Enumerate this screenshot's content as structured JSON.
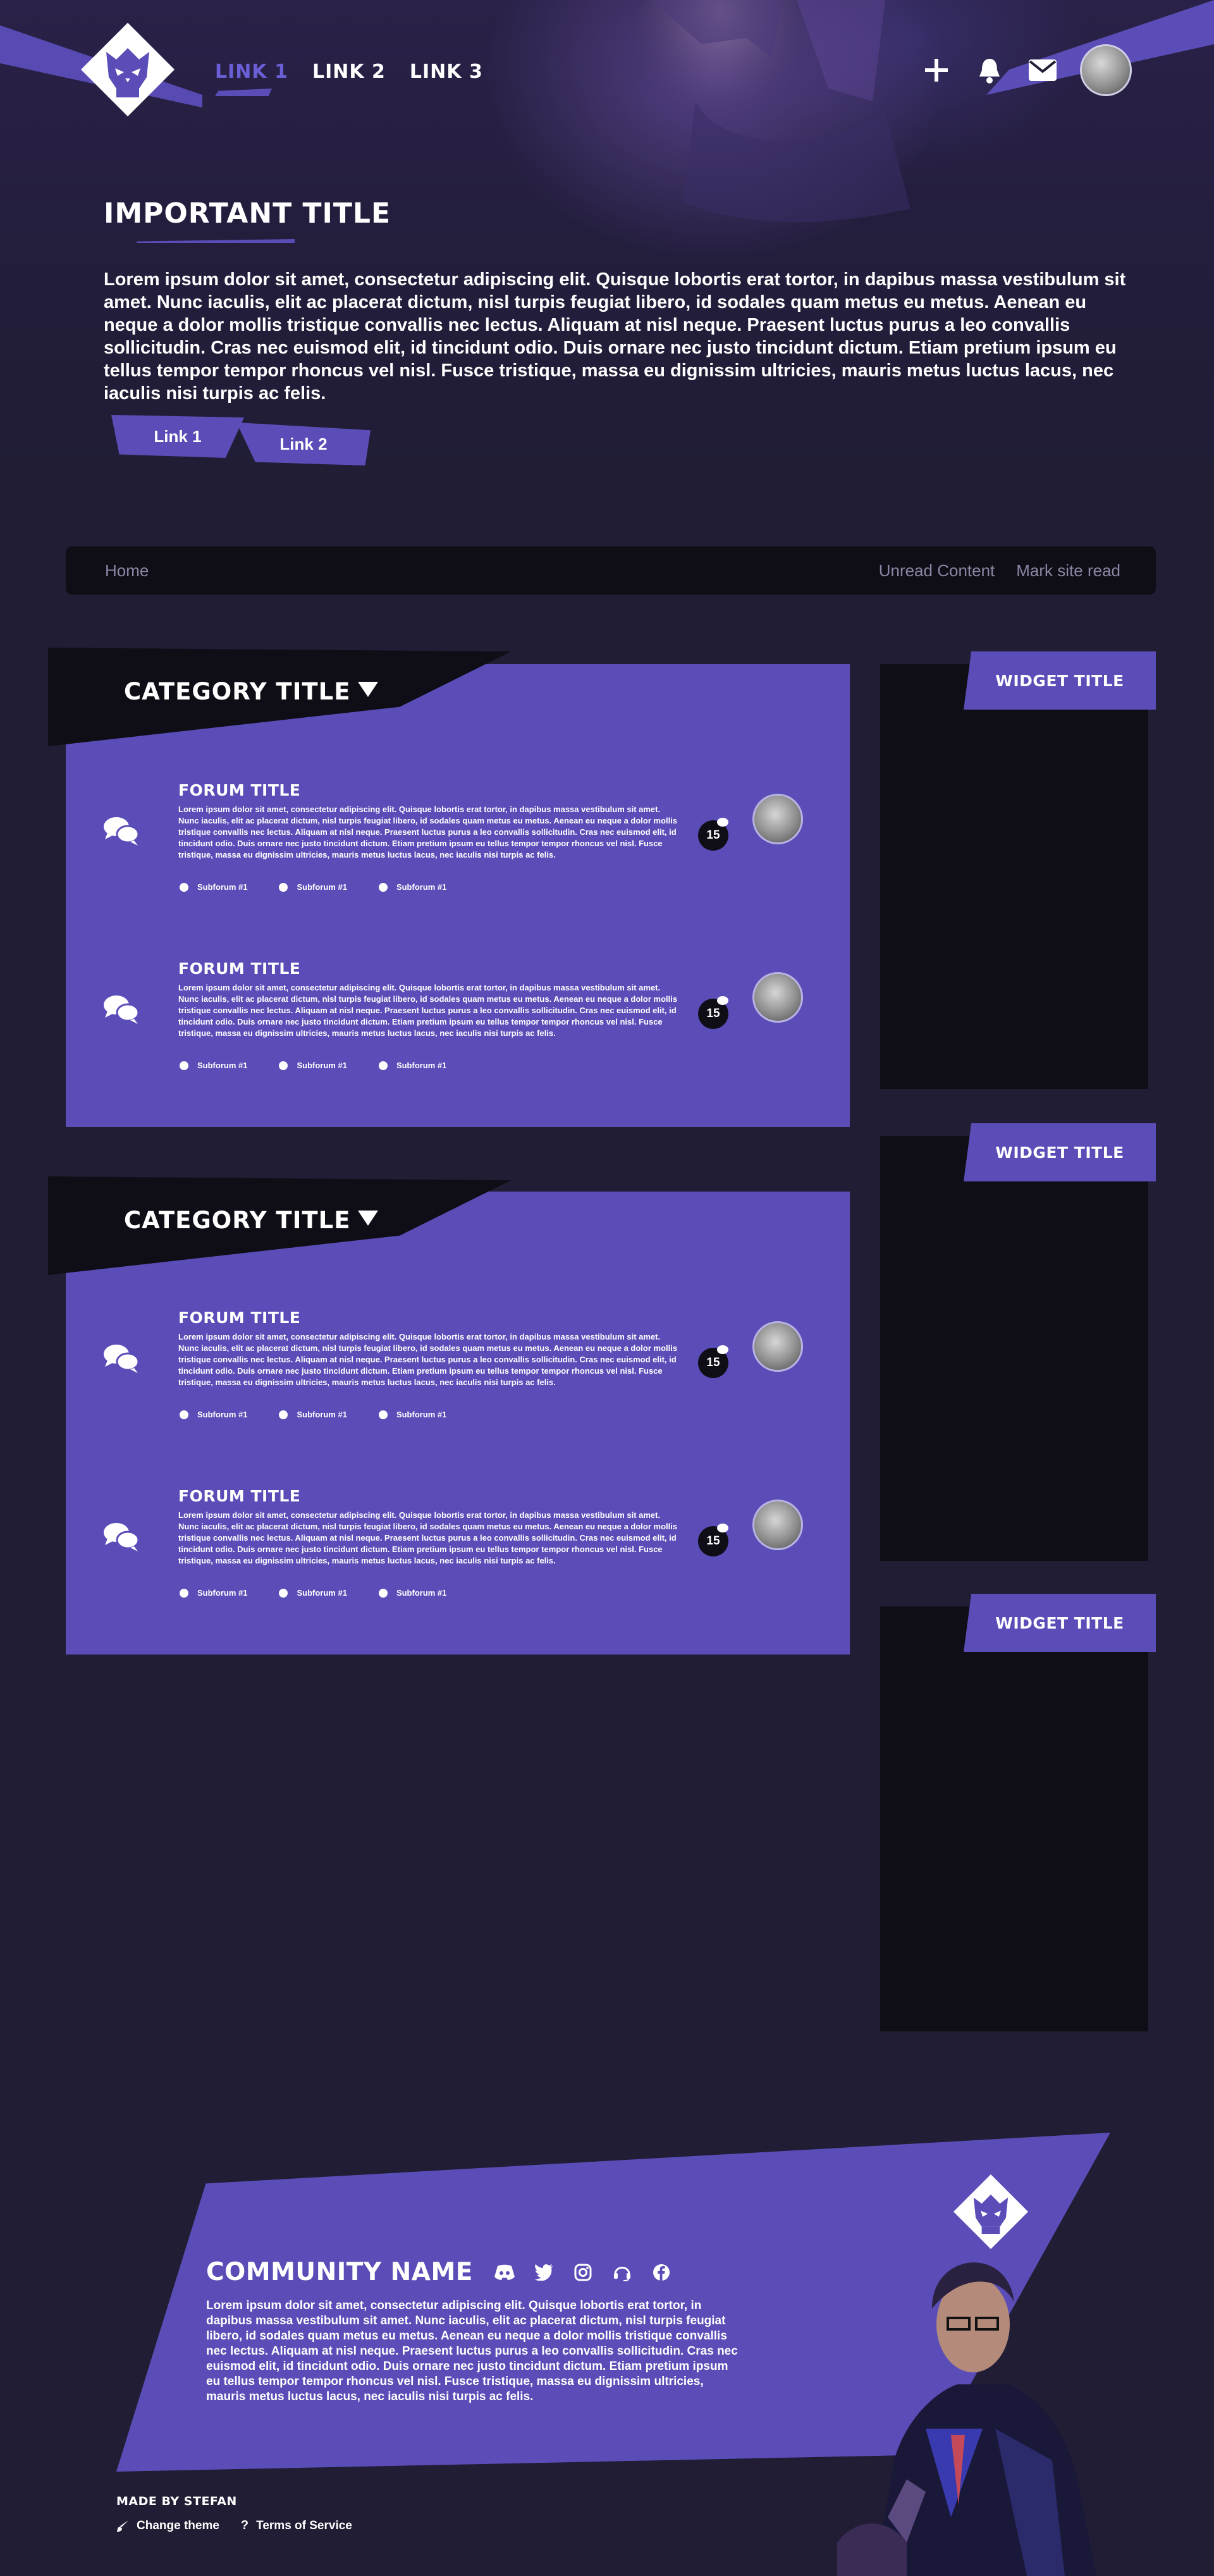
{
  "nav": {
    "links": [
      "LINK 1",
      "LINK 2",
      "LINK 3"
    ]
  },
  "hero": {
    "title": "IMPORTANT TITLE",
    "text": "Lorem ipsum dolor sit amet, consectetur adipiscing elit. Quisque lobortis erat tortor, in dapibus massa vestibulum sit amet. Nunc iaculis, elit ac placerat dictum, nisl turpis feugiat libero, id sodales quam metus eu metus. Aenean eu neque a dolor mollis tristique convallis nec lectus. Aliquam at nisl neque. Praesent luctus purus a leo convallis sollicitudin. Cras nec euismod elit, id tincidunt odio. Duis ornare nec justo tincidunt dictum. Etiam pretium ipsum eu tellus tempor tempor rhoncus vel nisl. Fusce tristique, massa eu dignissim ultricies, mauris metus luctus lacus, nec iaculis nisi turpis ac felis.",
    "button1": "Link 1",
    "button2": "Link 2"
  },
  "breadcrumb": {
    "home": "Home",
    "unread": "Unread Content",
    "mark_read": "Mark site read"
  },
  "categories": [
    {
      "title": "CATEGORY TITLE",
      "forums": [
        {
          "title": "FORUM TITLE",
          "desc": "Lorem ipsum dolor sit amet, consectetur adipiscing elit. Quisque lobortis erat tortor, in dapibus massa vestibulum sit amet. Nunc iaculis, elit ac placerat dictum, nisl turpis feugiat libero, id sodales quam metus eu metus. Aenean eu neque a dolor mollis tristique convallis nec lectus. Aliquam at nisl neque. Praesent luctus purus a leo convallis sollicitudin. Cras nec euismod elit, id tincidunt odio. Duis ornare nec justo tincidunt dictum. Etiam pretium ipsum eu tellus tempor tempor rhoncus vel nisl. Fusce tristique, massa eu dignissim ultricies, mauris metus luctus lacus, nec iaculis nisi turpis ac felis.",
          "subforums": [
            "Subforum #1",
            "Subforum #1",
            "Subforum #1"
          ],
          "count": "15"
        },
        {
          "title": "FORUM TITLE",
          "desc": "Lorem ipsum dolor sit amet, consectetur adipiscing elit. Quisque lobortis erat tortor, in dapibus massa vestibulum sit amet. Nunc iaculis, elit ac placerat dictum, nisl turpis feugiat libero, id sodales quam metus eu metus. Aenean eu neque a dolor mollis tristique convallis nec lectus. Aliquam at nisl neque. Praesent luctus purus a leo convallis sollicitudin. Cras nec euismod elit, id tincidunt odio. Duis ornare nec justo tincidunt dictum. Etiam pretium ipsum eu tellus tempor tempor rhoncus vel nisl. Fusce tristique, massa eu dignissim ultricies, mauris metus luctus lacus, nec iaculis nisi turpis ac felis.",
          "subforums": [
            "Subforum #1",
            "Subforum #1",
            "Subforum #1"
          ],
          "count": "15"
        }
      ]
    },
    {
      "title": "CATEGORY TITLE",
      "forums": [
        {
          "title": "FORUM TITLE",
          "desc": "Lorem ipsum dolor sit amet, consectetur adipiscing elit. Quisque lobortis erat tortor, in dapibus massa vestibulum sit amet. Nunc iaculis, elit ac placerat dictum, nisl turpis feugiat libero, id sodales quam metus eu metus. Aenean eu neque a dolor mollis tristique convallis nec lectus. Aliquam at nisl neque. Praesent luctus purus a leo convallis sollicitudin. Cras nec euismod elit, id tincidunt odio. Duis ornare nec justo tincidunt dictum. Etiam pretium ipsum eu tellus tempor tempor rhoncus vel nisl. Fusce tristique, massa eu dignissim ultricies, mauris metus luctus lacus, nec iaculis nisi turpis ac felis.",
          "subforums": [
            "Subforum #1",
            "Subforum #1",
            "Subforum #1"
          ],
          "count": "15"
        },
        {
          "title": "FORUM TITLE",
          "desc": "Lorem ipsum dolor sit amet, consectetur adipiscing elit. Quisque lobortis erat tortor, in dapibus massa vestibulum sit amet. Nunc iaculis, elit ac placerat dictum, nisl turpis feugiat libero, id sodales quam metus eu metus. Aenean eu neque a dolor mollis tristique convallis nec lectus. Aliquam at nisl neque. Praesent luctus purus a leo convallis sollicitudin. Cras nec euismod elit, id tincidunt odio. Duis ornare nec justo tincidunt dictum. Etiam pretium ipsum eu tellus tempor tempor rhoncus vel nisl. Fusce tristique, massa eu dignissim ultricies, mauris metus luctus lacus, nec iaculis nisi turpis ac felis.",
          "subforums": [
            "Subforum #1",
            "Subforum #1",
            "Subforum #1"
          ],
          "count": "15"
        }
      ]
    }
  ],
  "widgets": [
    "WIDGET TITLE",
    "WIDGET TITLE",
    "WIDGET TITLE"
  ],
  "footer": {
    "community_name": "COMMUNITY NAME",
    "desc": "Lorem ipsum dolor sit amet, consectetur adipiscing elit. Quisque lobortis erat tortor, in dapibus massa vestibulum sit amet. Nunc iaculis, elit ac placerat dictum, nisl turpis feugiat libero, id sodales quam metus eu metus. Aenean eu neque a dolor mollis tristique convallis nec lectus. Aliquam at nisl neque. Praesent luctus purus a leo convallis sollicitudin. Cras nec euismod elit, id tincidunt odio. Duis ornare nec justo tincidunt dictum. Etiam pretium ipsum eu tellus tempor tempor rhoncus vel nisl. Fusce tristique, massa eu dignissim ultricies, mauris metus luctus lacus, nec iaculis nisi turpis ac felis.",
    "made_by": "MADE BY STEFAN",
    "change_theme": "Change theme",
    "terms": "Terms of Service",
    "socials": [
      "discord-icon",
      "twitter-icon",
      "instagram-icon",
      "headset-icon",
      "facebook-icon"
    ]
  },
  "colors": {
    "accent": "#5a4db8",
    "background": "#201d34",
    "panel": "#0f0e17",
    "muted_text": "#8a87a4"
  }
}
